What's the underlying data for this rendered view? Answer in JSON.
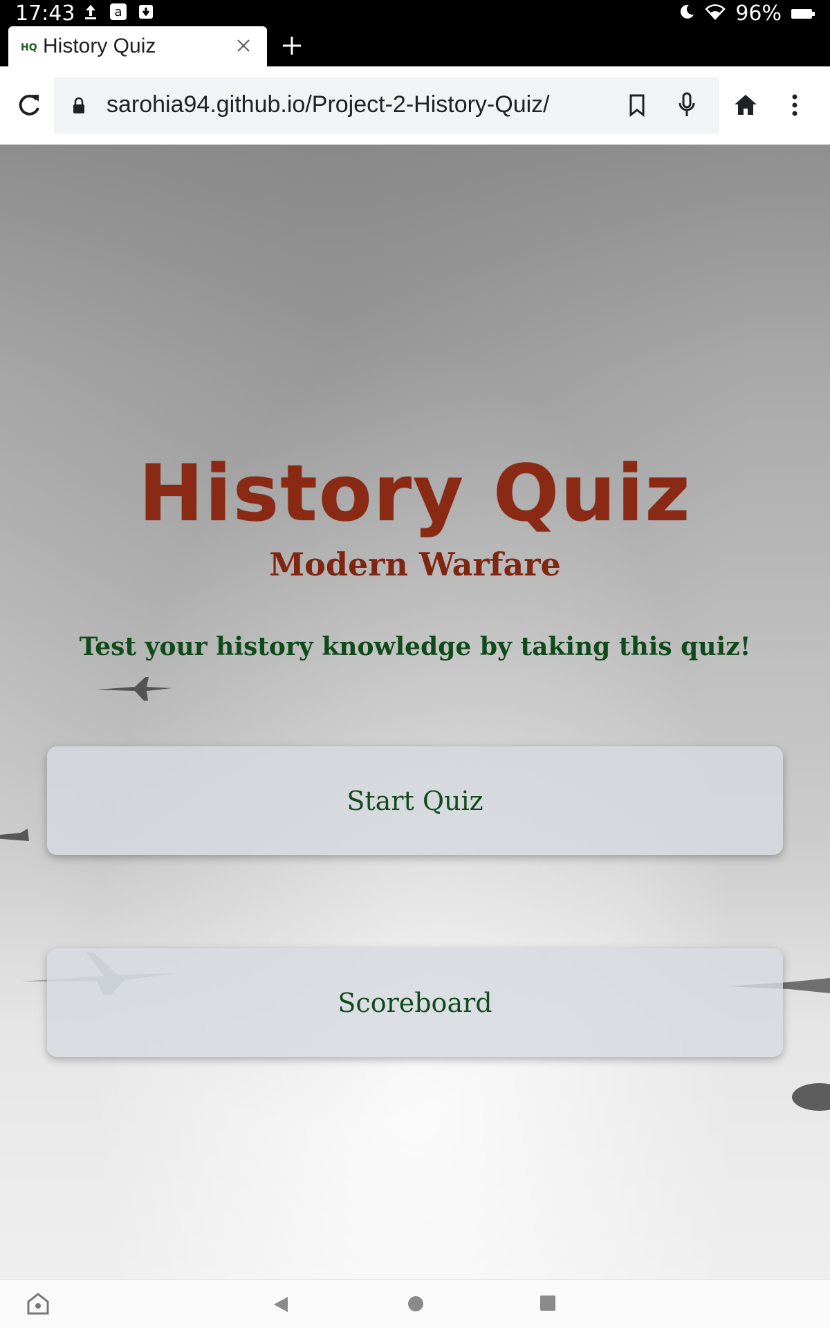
{
  "status_bar": {
    "time": "17:43",
    "battery": "96%",
    "icons": [
      "upload-icon",
      "amazon-icon",
      "download-icon",
      "moon-icon",
      "wifi-icon",
      "battery-icon"
    ]
  },
  "tab": {
    "favicon_text": "HQ",
    "title": "History Quiz"
  },
  "toolbar": {
    "url": "sarohia94.github.io/Project-2-History-Quiz/"
  },
  "page": {
    "heading": "History Quiz",
    "subtitle": "Modern Warfare",
    "tagline": "Test your history knowledge by taking this quiz!",
    "start_button": "Start Quiz",
    "scoreboard_button": "Scoreboard"
  },
  "colors": {
    "heading": "#8a2a14",
    "tagline": "#0f4a1a",
    "button_text": "#124a1c",
    "button_bg": "#d6dbdf"
  }
}
